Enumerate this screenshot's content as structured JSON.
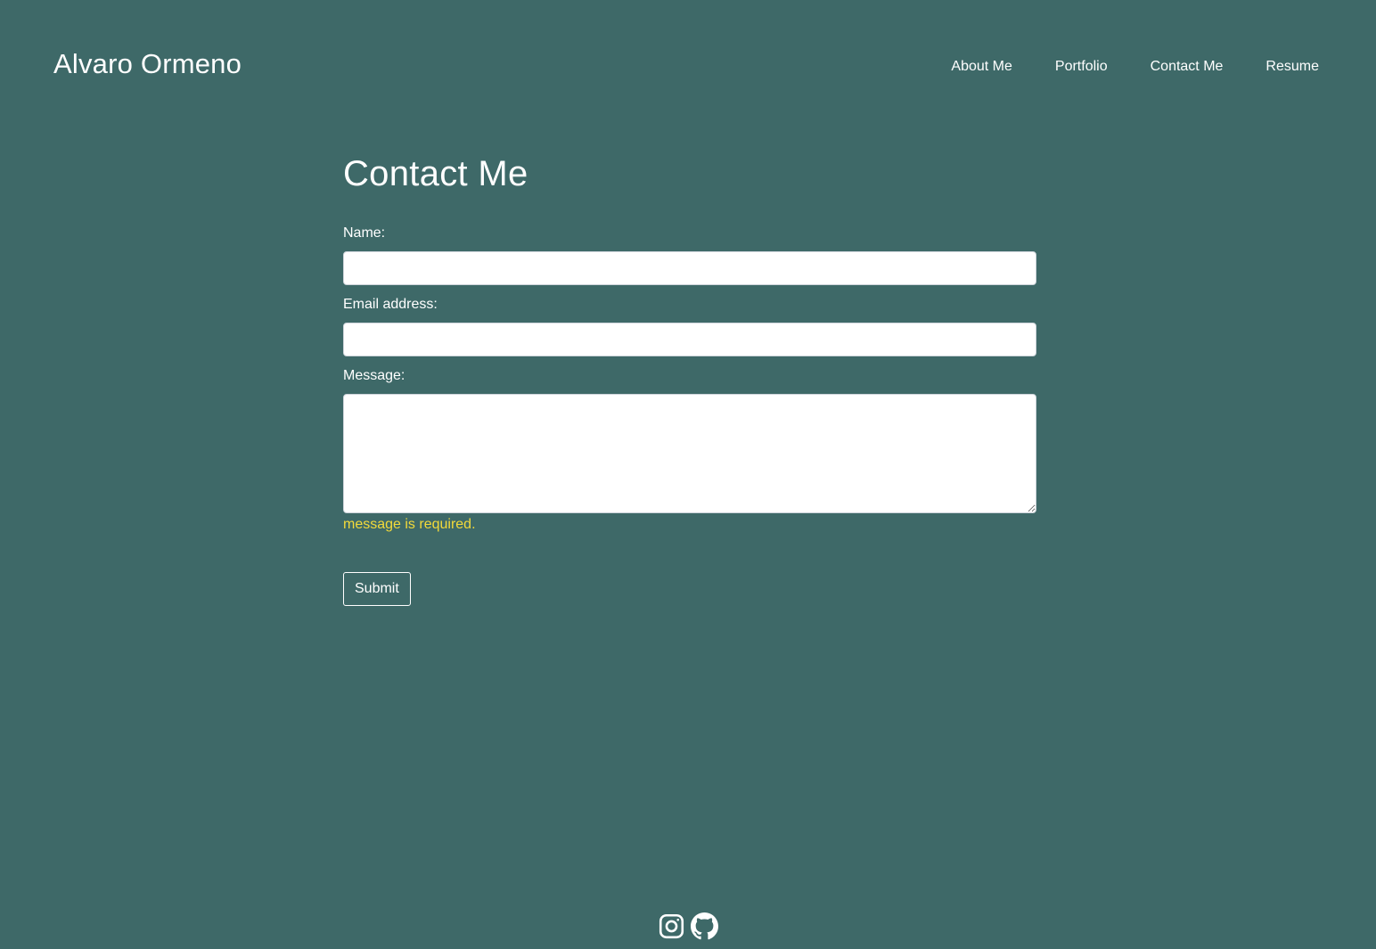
{
  "header": {
    "brand": "Alvaro Ormeno",
    "nav": [
      {
        "label": "About Me"
      },
      {
        "label": "Portfolio"
      },
      {
        "label": "Contact Me"
      },
      {
        "label": "Resume"
      }
    ]
  },
  "main": {
    "title": "Contact Me",
    "form": {
      "name_label": "Name:",
      "name_value": "",
      "email_label": "Email address:",
      "email_value": "",
      "message_label": "Message:",
      "message_value": "",
      "error": "message is required.",
      "submit_label": "Submit"
    }
  },
  "footer": {
    "icons": [
      "instagram-icon",
      "github-icon"
    ]
  },
  "colors": {
    "background": "#3e6968",
    "text": "#ffffff",
    "error": "#f2da3a"
  }
}
